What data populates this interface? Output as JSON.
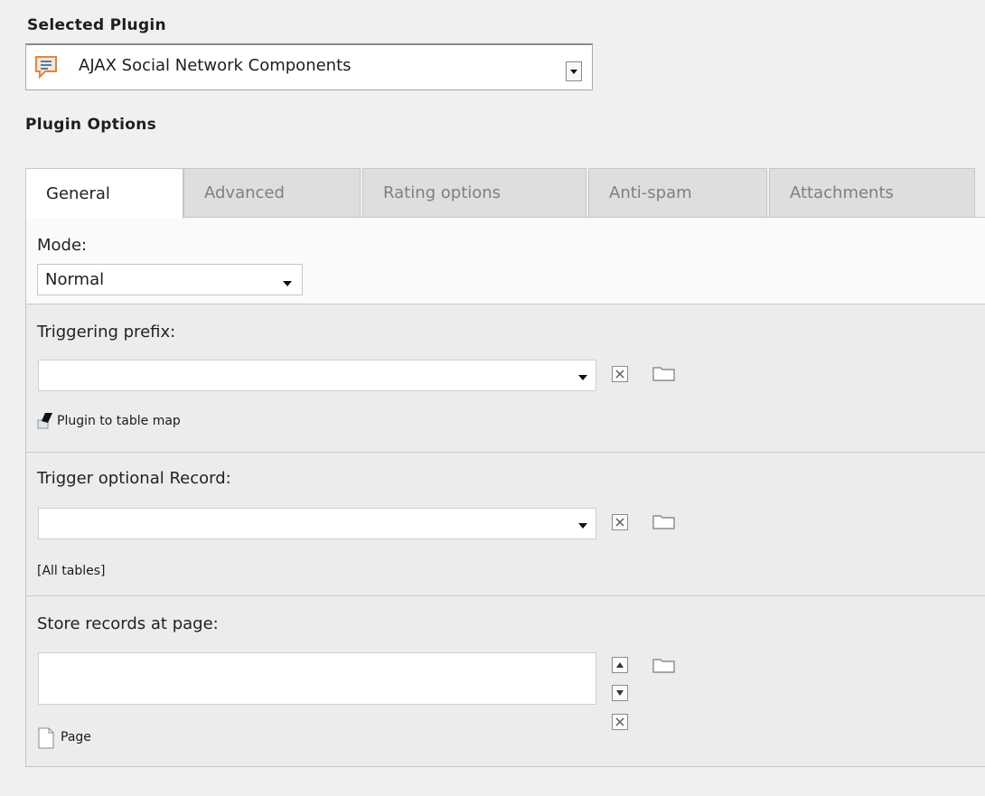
{
  "selected_plugin": {
    "heading": "Selected Plugin",
    "value": "AJAX Social Network Components",
    "icon": "comment-plugin-icon"
  },
  "plugin_options": {
    "heading": "Plugin Options"
  },
  "tabs": [
    {
      "label": "General",
      "active": true
    },
    {
      "label": "Advanced",
      "active": false
    },
    {
      "label": "Rating options",
      "active": false
    },
    {
      "label": "Anti-spam",
      "active": false
    },
    {
      "label": "Attachments",
      "active": false
    }
  ],
  "general": {
    "mode": {
      "label": "Mode:",
      "value": "Normal"
    },
    "triggering_prefix": {
      "label": "Triggering prefix:",
      "value": "",
      "link": "Plugin to table map"
    },
    "trigger_record": {
      "label": "Trigger optional Record:",
      "value": "",
      "note": "[All tables]"
    },
    "store_records": {
      "label": "Store records at page:",
      "value": "",
      "note": "Page"
    }
  },
  "colors": {
    "background": "#f0f0f0",
    "plugin_icon": "#e8843a",
    "active_tab": "#ffffff",
    "inactive_tab": "#dedede"
  }
}
